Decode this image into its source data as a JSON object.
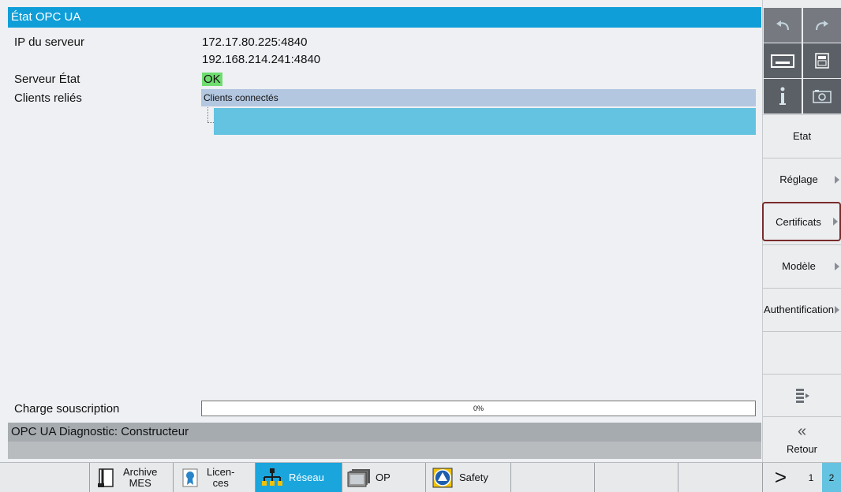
{
  "window": {
    "title": "État OPC UA"
  },
  "fields": {
    "server_ip_label": "IP du serveur",
    "server_ip_1": "172.17.80.225:4840",
    "server_ip_2": "192.168.214.241:4840",
    "server_state_label": "Serveur État",
    "server_state_value": "OK",
    "clients_label": "Clients reliés",
    "clients_header": "Clients connectés",
    "subscription_label": "Charge souscription",
    "subscription_text": "0%",
    "subscription_fraction": 0
  },
  "footer": {
    "status": "OPC UA Diagnostic: Constructeur"
  },
  "softkeys": {
    "etat": "Etat",
    "reglage": "Réglage",
    "certificats": "Certificats",
    "modele": "Modèle",
    "authentification": "Authentification",
    "retour": "Retour"
  },
  "toolbar": {
    "archive_line1": "Archive",
    "archive_line2": "MES",
    "licences_line1": "Licen-",
    "licences_line2": "ces",
    "reseau": "Réseau",
    "op": "OP",
    "safety": "Safety",
    "next": ">",
    "page1": "1",
    "page2": "2"
  },
  "colors": {
    "title_bar": "#0f9ed8",
    "ok_status": "#6fdc6f",
    "selected_softkey_border": "#7a2b2b",
    "active_tab": "#1aa5dc"
  }
}
